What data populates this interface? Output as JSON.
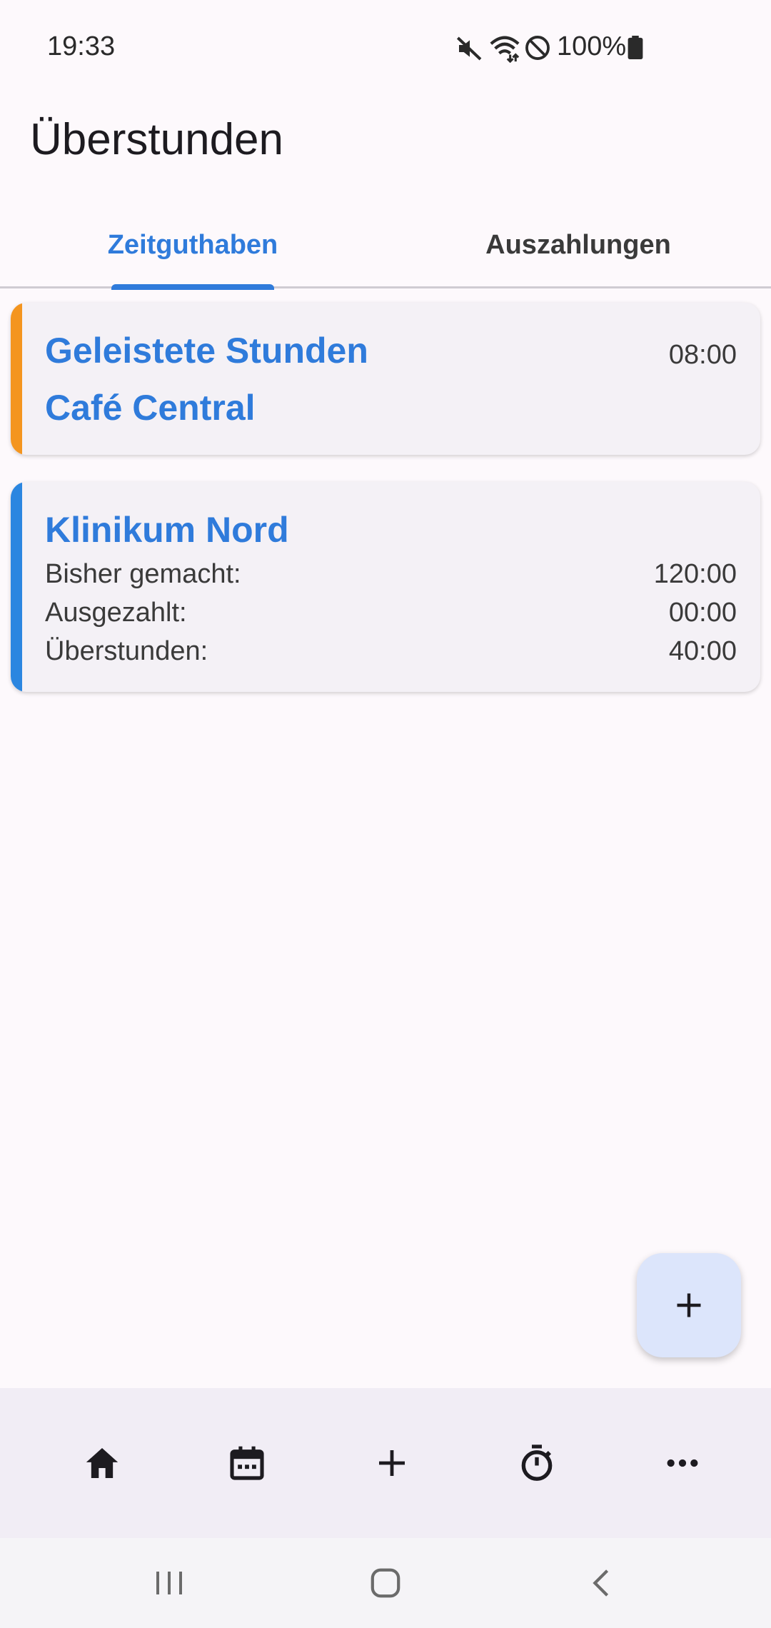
{
  "status_bar": {
    "time": "19:33",
    "battery_percent": "100%",
    "icons": [
      "mute-icon",
      "wifi-icon",
      "do-not-disturb-icon",
      "battery-icon"
    ]
  },
  "app_bar": {
    "title": "Überstunden"
  },
  "tabs": [
    {
      "label": "Zeitguthaben",
      "selected": true
    },
    {
      "label": "Auszahlungen",
      "selected": false
    }
  ],
  "cards": {
    "worked_hours": {
      "title": "Geleistete Stunden",
      "subtitle": "Café Central",
      "value": "08:00",
      "accent_color": "#f4951f"
    },
    "employer": {
      "title": "Klinikum Nord",
      "accent_color": "#2b86e0",
      "rows": [
        {
          "label": "Bisher gemacht:",
          "value": "120:00"
        },
        {
          "label": "Ausgezahlt:",
          "value": "00:00"
        },
        {
          "label": "Überstunden:",
          "value": "40:00"
        }
      ]
    }
  },
  "fab": {
    "icon": "plus-icon"
  },
  "bottom_nav": {
    "items": [
      "home-icon",
      "calendar-icon",
      "add-icon",
      "timer-icon",
      "more-icon"
    ]
  },
  "system_nav": {
    "items": [
      "recent-apps-icon",
      "home-button-icon",
      "back-icon"
    ]
  },
  "colors": {
    "accent": "#2f7bdb",
    "background": "#fdf9fc",
    "card_background": "#f4f1f6",
    "fab_background": "#dce5fb"
  }
}
